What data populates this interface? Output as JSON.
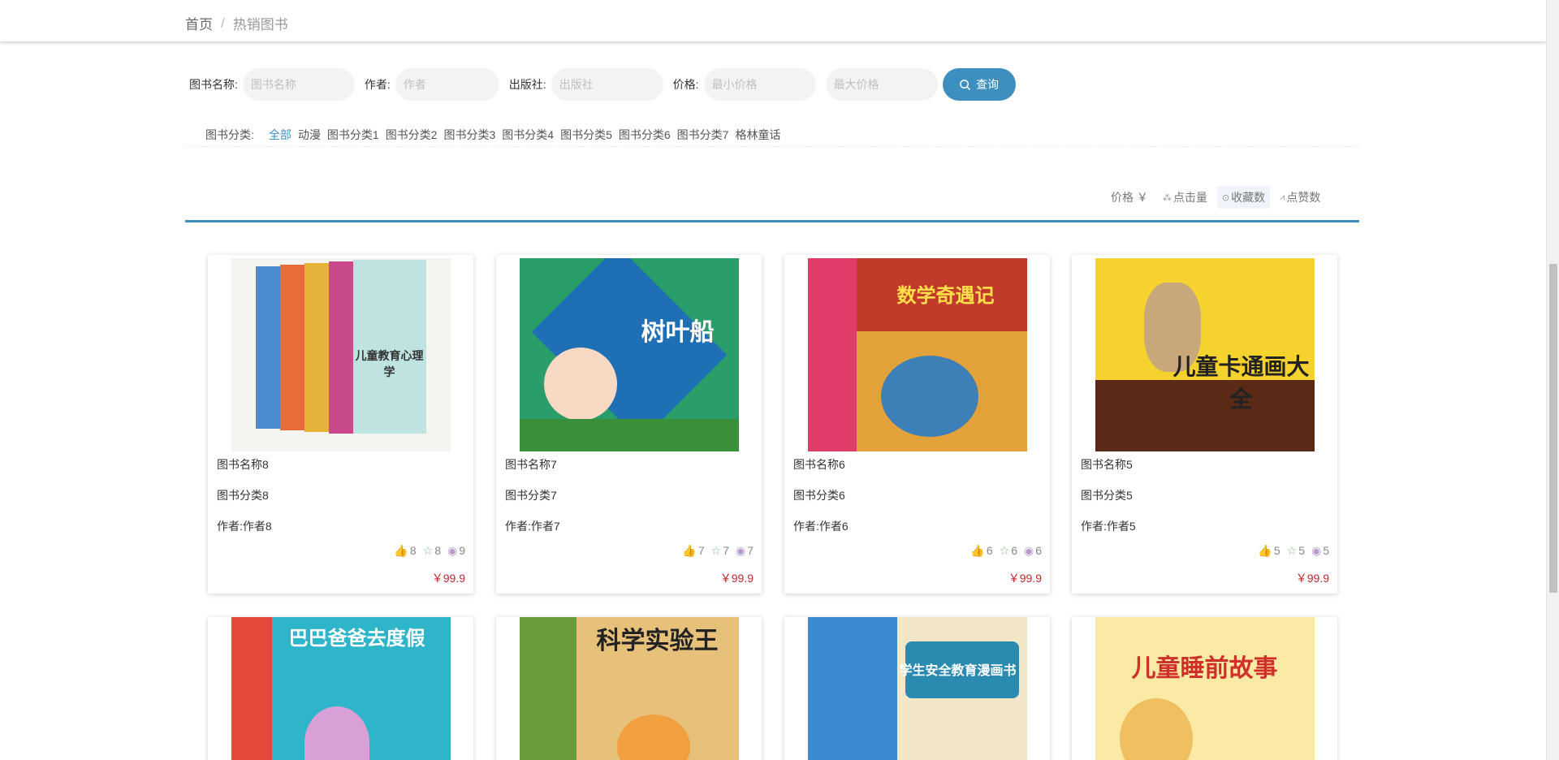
{
  "breadcrumb": {
    "home": "首页",
    "separator": "/",
    "current": "热销图书"
  },
  "search": {
    "name_label": "图书名称:",
    "name_placeholder": "图书名称",
    "author_label": "作者:",
    "author_placeholder": "作者",
    "publisher_label": "出版社:",
    "publisher_placeholder": "出版社",
    "price_label": "价格:",
    "min_price_placeholder": "最小价格",
    "max_price_placeholder": "最大价格",
    "query_button": "查询"
  },
  "categories": {
    "label": "图书分类:",
    "items": [
      "全部",
      "动漫",
      "图书分类1",
      "图书分类2",
      "图书分类3",
      "图书分类4",
      "图书分类5",
      "图书分类6",
      "图书分类7",
      "格林童话"
    ],
    "active": "全部"
  },
  "sort": {
    "price": "价格 ￥",
    "clicks": "点击量",
    "favorites": "收藏数",
    "likes": "点赞数",
    "active": "favorites"
  },
  "books": [
    {
      "name": "图书名称8",
      "category": "图书分类8",
      "author": "作者:作者8",
      "likes": "8",
      "favs": "8",
      "views": "9",
      "price": "￥99.9",
      "cover_text": "儿童教育心理学"
    },
    {
      "name": "图书名称7",
      "category": "图书分类7",
      "author": "作者:作者7",
      "likes": "7",
      "favs": "7",
      "views": "7",
      "price": "￥99.9",
      "cover_text": "树叶船"
    },
    {
      "name": "图书名称6",
      "category": "图书分类6",
      "author": "作者:作者6",
      "likes": "6",
      "favs": "6",
      "views": "6",
      "price": "￥99.9",
      "cover_text": "数学奇遇记"
    },
    {
      "name": "图书名称5",
      "category": "图书分类5",
      "author": "作者:作者5",
      "likes": "5",
      "favs": "5",
      "views": "5",
      "price": "￥99.9",
      "cover_text": "儿童卡通画大全"
    }
  ],
  "books_row2": [
    {
      "cover_text": "巴巴爸爸去度假"
    },
    {
      "cover_text": "科学实验王"
    },
    {
      "cover_text": "学生安全教育漫画书"
    },
    {
      "cover_text": "儿童睡前故事"
    }
  ]
}
